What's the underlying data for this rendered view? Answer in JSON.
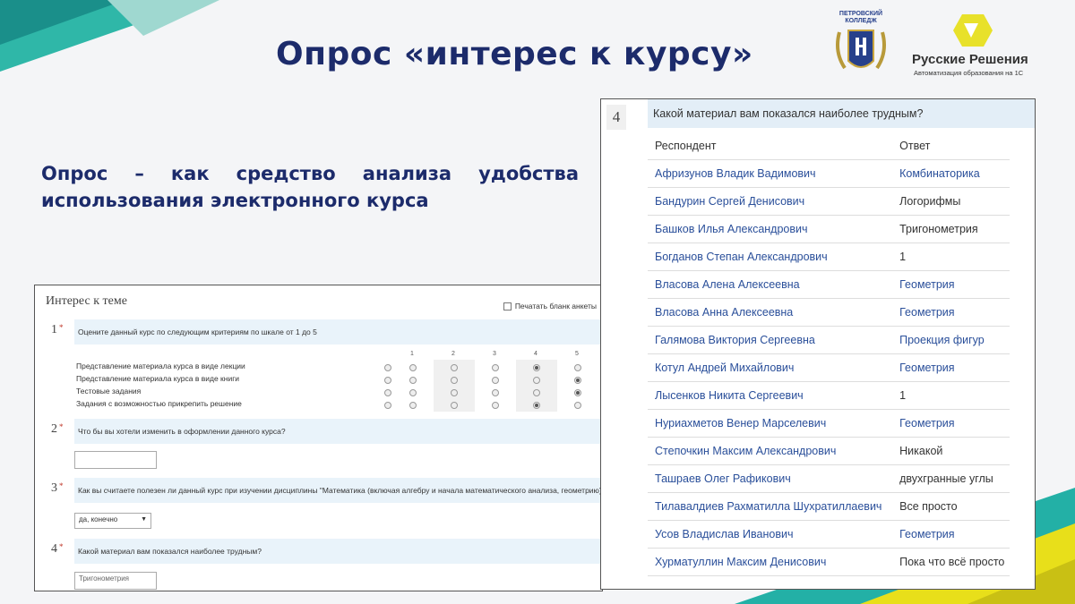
{
  "slide": {
    "title": "Опрос «интерес к курсу»",
    "subtitle_line1": "Опрос – как средство анализа удобства",
    "subtitle_line2": "использования электронного курса"
  },
  "logos": {
    "college_caption_line1": "ПЕТРОВСКИЙ",
    "college_caption_line2": "КОЛЛЕДЖ",
    "brand_name": "Русские Решения",
    "brand_tagline": "Автоматизация образования на 1С"
  },
  "colors": {
    "title": "#1c2b6b",
    "accent_teal": "#1aa6a0",
    "accent_yellow": "#e8df1a",
    "link": "#2a4f9a"
  },
  "form": {
    "title": "Интерес к теме",
    "print_label": "Печатать бланк анкеты",
    "q1": {
      "num": "1",
      "text": "Оцените данный курс по следующим критериям по  шкале от 1 до 5",
      "scale": [
        "1",
        "2",
        "3",
        "4",
        "5"
      ],
      "criteria": [
        "Представление материала курса в виде лекции",
        "Представление материала курса в виде книги",
        "Тестовые задания",
        "Задания с возможностью прикрепить решение"
      ]
    },
    "q2": {
      "num": "2",
      "text": "Что бы вы хотели изменить в оформлении данного курса?",
      "value": ""
    },
    "q3": {
      "num": "3",
      "text": "Как вы считаете полезен ли данный курс при изучении дисциплины \"Математика (включая алгебру и начала математического анализа, геометрию)\"",
      "value": "да, конечно"
    },
    "q4": {
      "num": "4",
      "text": "Какой материал вам показался наиболее трудным?",
      "value": "Тригонометрия"
    }
  },
  "responses": {
    "num": "4",
    "question": "Какой материал вам показался наиболее трудным?",
    "headers": {
      "respondent": "Респондент",
      "answer": "Ответ"
    },
    "rows": [
      {
        "name": "Афризунов Владик Вадимович",
        "answer": "Комбинаторика",
        "answer_link": true
      },
      {
        "name": "Бандурин Сергей Денисович",
        "answer": "Логорифмы",
        "answer_link": false
      },
      {
        "name": "Башков Илья Александрович",
        "answer": "Тригонометрия",
        "answer_link": false
      },
      {
        "name": "Богданов Степан Александрович",
        "answer": "1",
        "answer_link": false
      },
      {
        "name": "Власова Алена Алексеевна",
        "answer": "Геометрия",
        "answer_link": true
      },
      {
        "name": "Власова Анна Алексеевна",
        "answer": "Геометрия",
        "answer_link": true
      },
      {
        "name": "Галямова Виктория Сергеевна",
        "answer": "Проекция фигур",
        "answer_link": true
      },
      {
        "name": "Котул Андрей Михайлович",
        "answer": "Геометрия",
        "answer_link": true
      },
      {
        "name": "Лысенков Никита Сергеевич",
        "answer": "1",
        "answer_link": false
      },
      {
        "name": "Нуриахметов Венер Марселевич",
        "answer": "Геометрия",
        "answer_link": true
      },
      {
        "name": "Степочкин Максим Александрович",
        "answer": "Никакой",
        "answer_link": false
      },
      {
        "name": "Ташраев Олег Рафикович",
        "answer": "двухгранные углы",
        "answer_link": false
      },
      {
        "name": "Тилавалдиев Рахматилла Шухратиллаевич",
        "answer": "Все просто",
        "answer_link": false
      },
      {
        "name": "Усов Владислав Иванович",
        "answer": "Геометрия",
        "answer_link": true
      },
      {
        "name": "Хурматуллин Максим Денисович",
        "answer": "Пока что всё просто",
        "answer_link": false
      }
    ]
  }
}
